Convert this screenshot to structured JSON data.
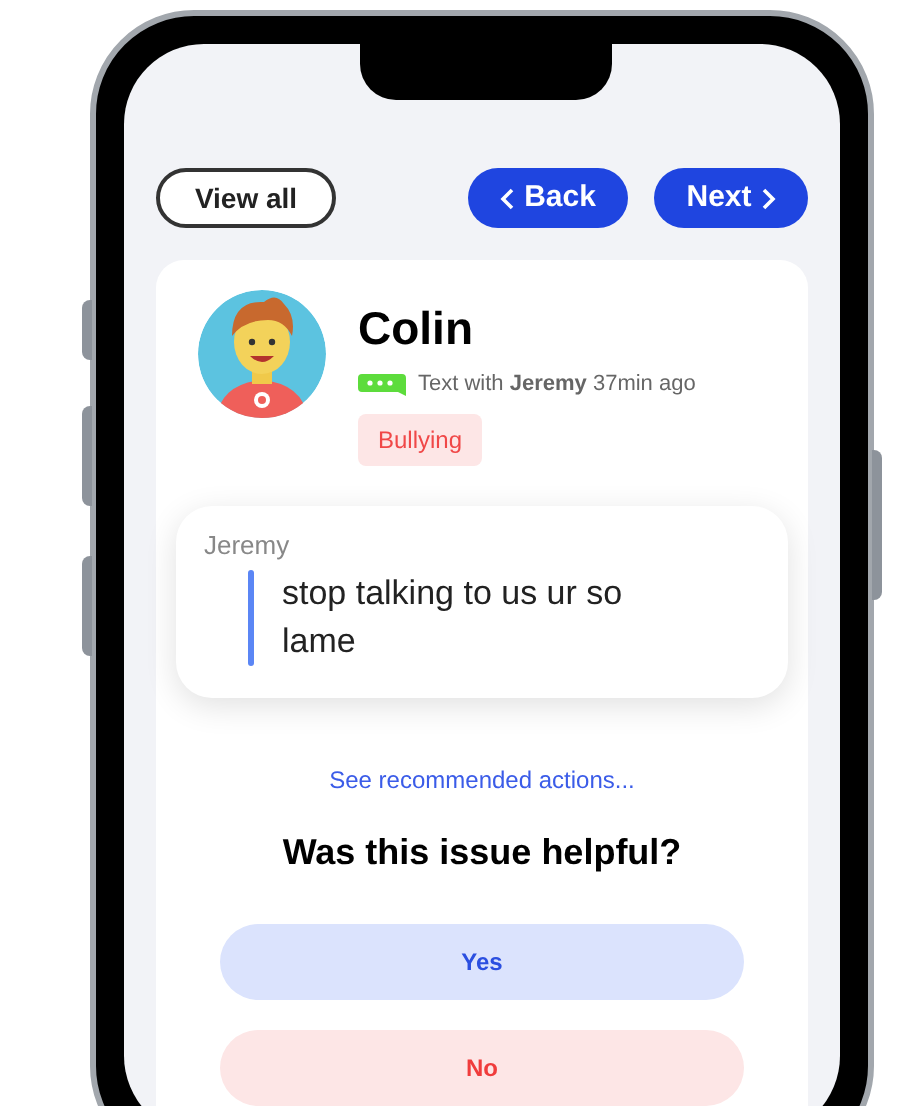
{
  "nav": {
    "buttons": [
      {
        "label": "View all",
        "kind": "outline"
      },
      {
        "label": "Back",
        "kind": "back"
      },
      {
        "label": "Next",
        "kind": "next"
      }
    ]
  },
  "profile": {
    "name": "Colin",
    "meta": "Text with **Jeremy** 37min ago",
    "tag": "Bullying"
  },
  "message": {
    "sender": "Jeremy",
    "text": "stop talking to us ur so lame"
  },
  "link": "See recommended actions...",
  "question": "Was this issue helpful?",
  "answers": [
    {
      "label": "Yes",
      "kind": "yes"
    },
    {
      "label": "No",
      "kind": "no"
    }
  ]
}
